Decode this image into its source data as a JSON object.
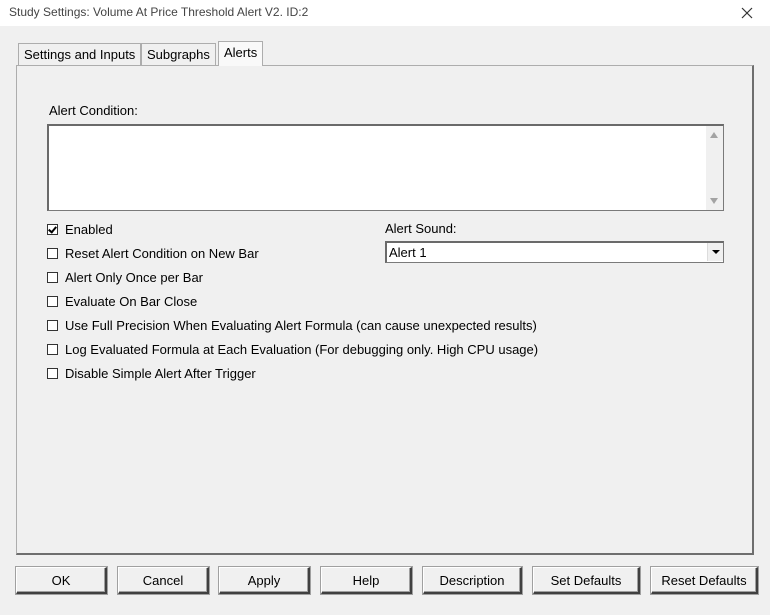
{
  "window": {
    "title": "Study Settings: Volume At Price Threshold Alert V2. ID:2",
    "close_icon": "close-icon"
  },
  "tabs": [
    {
      "label": "Settings and Inputs",
      "active": false
    },
    {
      "label": "Subgraphs",
      "active": false
    },
    {
      "label": "Alerts",
      "active": true
    }
  ],
  "alerts": {
    "condition_label": "Alert Condition:",
    "condition_value": "",
    "sound_label": "Alert Sound:",
    "sound_value": "Alert 1",
    "options": [
      {
        "label": "Enabled",
        "checked": true
      },
      {
        "label": "Reset Alert Condition on New Bar",
        "checked": false
      },
      {
        "label": "Alert Only Once per Bar",
        "checked": false
      },
      {
        "label": "Evaluate On Bar Close",
        "checked": false
      },
      {
        "label": "Use Full Precision When Evaluating Alert Formula (can cause unexpected results)",
        "checked": false
      },
      {
        "label": "Log Evaluated Formula at Each Evaluation (For debugging only. High CPU usage)",
        "checked": false
      },
      {
        "label": "Disable Simple Alert After Trigger",
        "checked": false
      }
    ]
  },
  "buttons": {
    "ok": "OK",
    "cancel": "Cancel",
    "apply": "Apply",
    "help": "Help",
    "description": "Description",
    "set_defaults": "Set Defaults",
    "reset_defaults": "Reset Defaults"
  }
}
